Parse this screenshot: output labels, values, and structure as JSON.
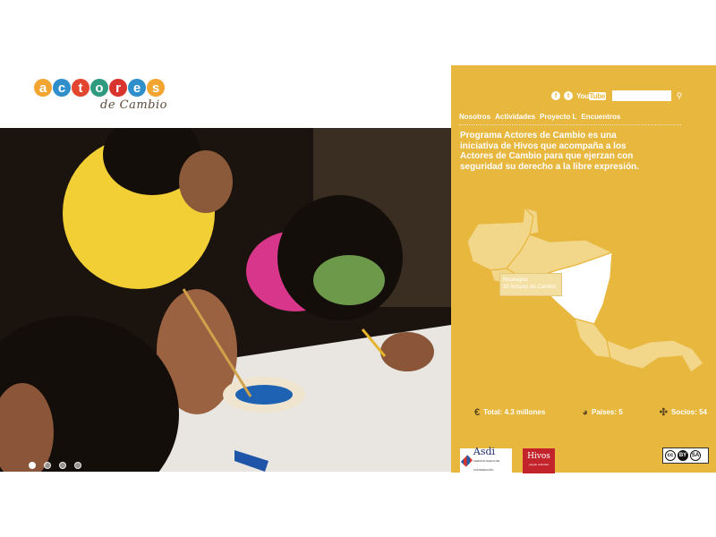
{
  "logo": {
    "letters": [
      {
        "char": "a",
        "color": "#f2a531"
      },
      {
        "char": "c",
        "color": "#2f8fcb"
      },
      {
        "char": "t",
        "color": "#e2462e"
      },
      {
        "char": "o",
        "color": "#2e9a7e"
      },
      {
        "char": "r",
        "color": "#d8342d"
      },
      {
        "char": "e",
        "color": "#2f8fcb"
      },
      {
        "char": "s",
        "color": "#f2a531"
      }
    ],
    "subtitle": "de Cambio"
  },
  "slider": {
    "dot_count": 4,
    "active_index": 0
  },
  "header": {
    "social_icons": [
      "facebook-icon",
      "twitter-icon"
    ],
    "youtube_a": "You",
    "youtube_b": "Tube",
    "search_placeholder": "",
    "search_icon": "⚲"
  },
  "nav": {
    "items": [
      "Nosotros",
      "Actividades",
      "Proyecto L",
      "Encuentros"
    ]
  },
  "intro": "Programa Actores de Cambio es una iniciativa de Hivos que acompaña a los Actores de Cambio para que ejerzan con seguridad su derecho a la libre expresión.",
  "map": {
    "highlighted_country": "Nicaragua",
    "tooltip_line1": "Nicaragua",
    "tooltip_line2": "32 Actores de Cambio",
    "colors": {
      "base": "#f2d68a",
      "highlight": "#ffffff",
      "border": "#e8b73e"
    }
  },
  "stats": {
    "total": "Total: 4.3 millones",
    "paises": "Países: 5",
    "socios": "Socios: 54"
  },
  "sponsors": {
    "asdi": "Asdi",
    "asdi_sub": "AGENCIA SUECA DE COOPERACIÓN",
    "hivos": "Hivos",
    "hivos_sub": "people unlimited"
  },
  "license": {
    "cc": "cc",
    "by": "BY",
    "sa": "SA"
  },
  "colors": {
    "panel": "#e8b73e",
    "text": "#ffffff"
  }
}
